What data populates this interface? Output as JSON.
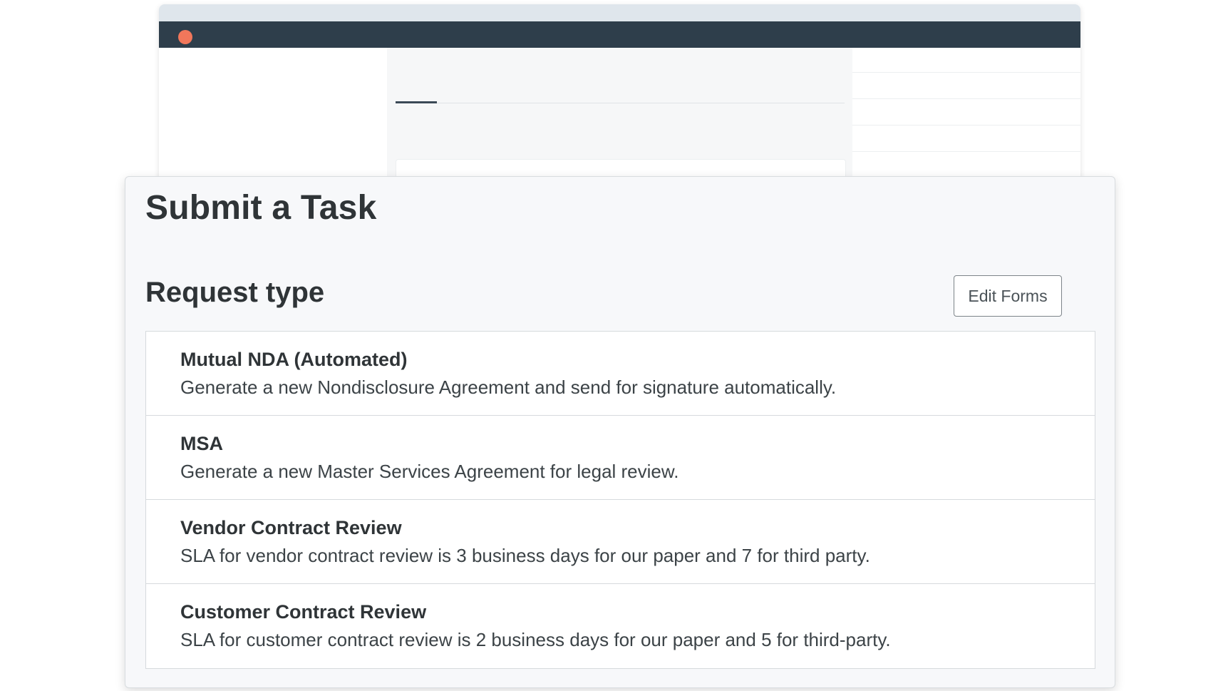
{
  "modal": {
    "title": "Submit a Task",
    "section_title": "Request type",
    "edit_forms_label": "Edit Forms",
    "request_types": [
      {
        "name": "Mutual NDA (Automated)",
        "description": "Generate a new Nondisclosure Agreement and send for signature automatically."
      },
      {
        "name": "MSA",
        "description": "Generate a new Master Services Agreement for legal review."
      },
      {
        "name": "Vendor Contract Review",
        "description": "SLA for vendor contract review is 3 business days for our paper and 7 for third party."
      },
      {
        "name": "Customer Contract Review",
        "description": "SLA for customer contract review is 2 business days for our paper and 5 for third-party."
      }
    ]
  },
  "colors": {
    "accent_dot": "#f1775b",
    "titlebar": "#2e3e4b",
    "heading_text": "#2f3437"
  }
}
